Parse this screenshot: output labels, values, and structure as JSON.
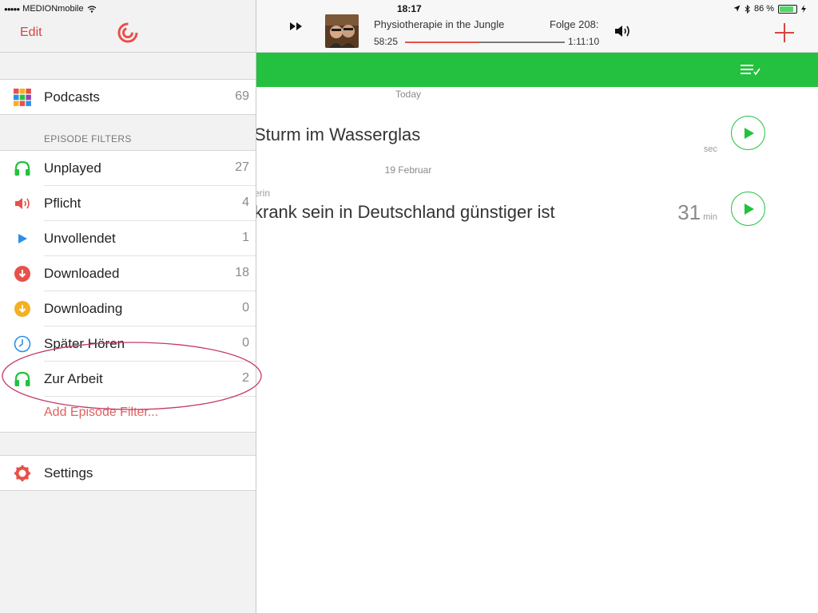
{
  "status_bar": {
    "carrier": "MEDIONmobile",
    "time": "18:17",
    "battery": "86 %",
    "battery_level": 0.86
  },
  "sidebar": {
    "edit_label": "Edit",
    "logo_icon": "pocketcasts-logo",
    "podcasts": {
      "label": "Podcasts",
      "count": "69",
      "icon": "grid-icon"
    },
    "filters_title": "EPISODE FILTERS",
    "filters": [
      {
        "label": "Unplayed",
        "count": "27",
        "icon": "headphones-icon",
        "color": "#23c13f"
      },
      {
        "label": "Pflicht",
        "count": "4",
        "icon": "speaker-icon",
        "color": "#e8504b"
      },
      {
        "label": "Unvollendet",
        "count": "1",
        "icon": "play-icon",
        "color": "#2a8fe8"
      },
      {
        "label": "Downloaded",
        "count": "18",
        "icon": "download-icon",
        "color": "#e8504b"
      },
      {
        "label": "Downloading",
        "count": "0",
        "icon": "downloading-icon",
        "color": "#f5b021"
      },
      {
        "label": "Später Hören",
        "count": "0",
        "icon": "clock-icon",
        "color": "#2a8fe8"
      },
      {
        "label": "Zur Arbeit",
        "count": "2",
        "icon": "headphones-icon",
        "color": "#23c13f"
      }
    ],
    "add_filter_label": "Add Episode Filter...",
    "settings_label": "Settings",
    "highlight_color": "#c23b6a"
  },
  "player": {
    "podcast_title": "Physiotherapie in the Jungle",
    "episode": "Folge 208:",
    "elapsed": "58:25",
    "total": "1:11:10",
    "progress": 0.46
  },
  "theme": {
    "accent_green": "#23c13f",
    "accent_red": "#d64541"
  },
  "episodes": {
    "groups": [
      {
        "date": "Today",
        "title": "Sturm im Wasserglas",
        "subtitle": "",
        "duration_value": "",
        "duration_unit": "sec"
      },
      {
        "date": "19 Februar",
        "title": "krank sein in Deutschland günstiger ist",
        "subtitle": "erin",
        "duration_value": "31",
        "duration_unit": "min"
      }
    ]
  }
}
